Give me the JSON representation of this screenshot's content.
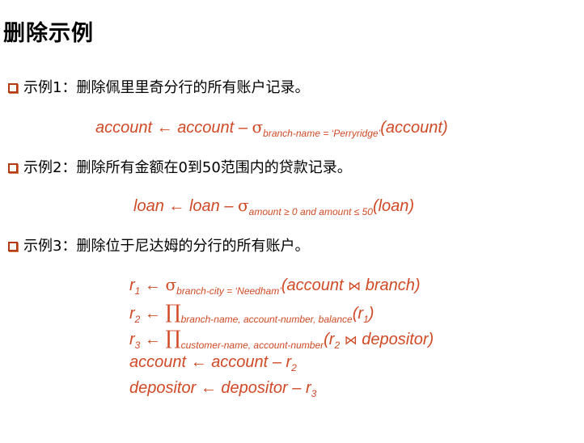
{
  "title": "删除示例",
  "examples": [
    {
      "label": "示例1：删除佩里里奇分行的所有账户记录。"
    },
    {
      "label": "示例2：删除所有金额在0到50范围内的贷款记录。"
    },
    {
      "label": "示例3：删除位于尼达姆的分行的所有账户。"
    }
  ],
  "f1": {
    "lhs": "account",
    "arrow": "←",
    "rel1": "account",
    "minus": "–",
    "sigma": "σ",
    "cond": "branch-name = ‘Perryridge’",
    "arg": "(account)"
  },
  "f2": {
    "lhs": "loan",
    "arrow": "←",
    "rel1": "loan",
    "minus": "–",
    "sigma": "σ",
    "cond": "amount ≥ 0 and amount ≤ 50",
    "arg": "(loan)"
  },
  "f3": {
    "l1": {
      "var": "r",
      "idx": "1",
      "arrow": "←",
      "sigma": "σ",
      "cond": "branch-city = ‘Needham’",
      "open": "(account",
      "join": "⋈",
      "close": "branch)"
    },
    "l2": {
      "var": "r",
      "idx": "2",
      "arrow": "←",
      "pi": "∏",
      "attrs": "branch-name, account-number, balance",
      "open": "(r",
      "argidx": "1",
      "close": ")"
    },
    "l3": {
      "var": "r",
      "idx": "3",
      "arrow": "←",
      "pi": "∏",
      "attrs": "customer-name, account-number",
      "open": "(r",
      "argidx": "2",
      "join": "⋈",
      "close": "depositor)"
    },
    "l4": {
      "lhs": "account",
      "arrow": "←",
      "rel": "account",
      "minus": "–",
      "var": "r",
      "idx": "2"
    },
    "l5": {
      "lhs": "depositor",
      "arrow": "←",
      "rel": "depositor",
      "minus": "–",
      "var": "r",
      "idx": "3"
    }
  }
}
